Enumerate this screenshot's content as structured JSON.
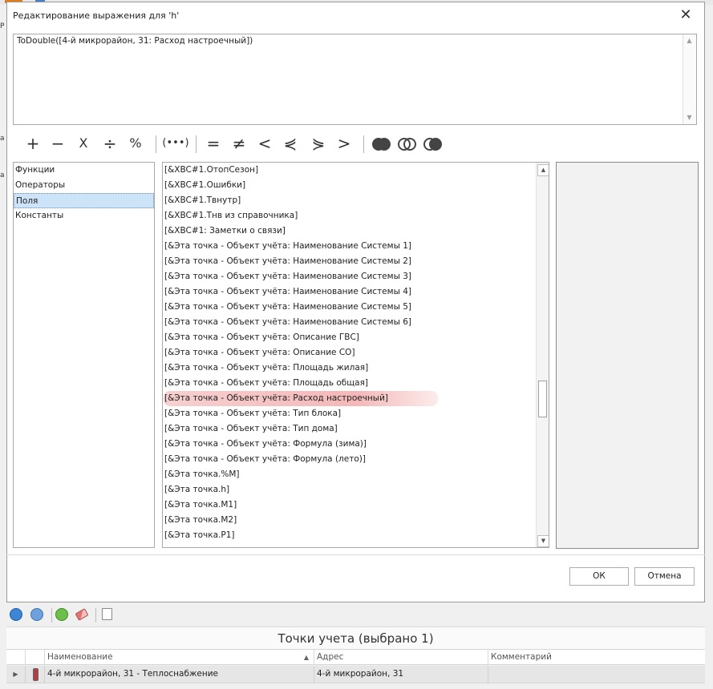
{
  "dialog": {
    "title": "Редактирование выражения для 'h'",
    "close_glyph": "✕",
    "expression": "ToDouble([4-й микрорайон, 31: Расход настроечный])"
  },
  "operators": {
    "plus": "+",
    "minus": "−",
    "multiply": "X",
    "divide": "÷",
    "percent": "%",
    "parens": "(•••)",
    "equal": "=",
    "not_equal": "≠",
    "less": "<",
    "less_equal": "⋞",
    "greater_equal": "⋟",
    "greater": ">",
    "logic_icons": [
      "and-rings-icon",
      "or-rings-icon",
      "not-rings-icon"
    ]
  },
  "categories": [
    "Функции",
    "Операторы",
    "Поля",
    "Константы"
  ],
  "selected_category": "Поля",
  "fields": [
    "[&XBC#1.ОтопСезон]",
    "[&XBC#1.Ошибки]",
    "[&XBC#1.Твнутр]",
    "[&XBC#1.Тнв из справочника]",
    "[&XBC#1: Заметки о связи]",
    "[&Эта точка - Объект учёта: Наименование Системы 1]",
    "[&Эта точка - Объект учёта: Наименование Системы 2]",
    "[&Эта точка - Объект учёта: Наименование Системы 3]",
    "[&Эта точка - Объект учёта: Наименование Системы 4]",
    "[&Эта точка - Объект учёта: Наименование Системы 5]",
    "[&Эта точка - Объект учёта: Наименование Системы 6]",
    "[&Эта точка - Объект учёта: Описание ГВС]",
    "[&Эта точка - Объект учёта: Описание СО]",
    "[&Эта точка - Объект учёта: Площадь жилая]",
    "[&Эта точка - Объект учёта: Площадь общая]",
    "[&Эта точка - Объект учёта: Расход настроечный]",
    "[&Эта точка - Объект учёта: Тип блока]",
    "[&Эта точка - Объект учёта: Тип дома]",
    "[&Эта точка - Объект учёта: Формула (зима)]",
    "[&Эта точка - Объект учёта: Формула (лето)]",
    "[&Эта точка.%M]",
    "[&Эта точка.h]",
    "[&Эта точка.M1]",
    "[&Эта точка.M2]",
    "[&Эта точка.P1]"
  ],
  "highlighted_field": "[&Эта точка - Объект учёта: Расход настроечный]",
  "buttons": {
    "ok": "ОК",
    "cancel": "Отмена"
  },
  "background": {
    "left_edge_chars": [
      "P",
      "а",
      "а"
    ]
  },
  "points_panel": {
    "title": "Точки учета (выбрано 1)",
    "columns": [
      "Наименование",
      "Адрес",
      "Комментарий"
    ],
    "rows": [
      {
        "name": "4-й микрорайон, 31 - Теплоснабжение",
        "address": "4-й микрорайон, 31",
        "comment": ""
      }
    ]
  },
  "colors": {
    "highlight": "#f0a8a8",
    "selected_row": "#cde3f7",
    "row_bg": "#e6e6e6"
  }
}
